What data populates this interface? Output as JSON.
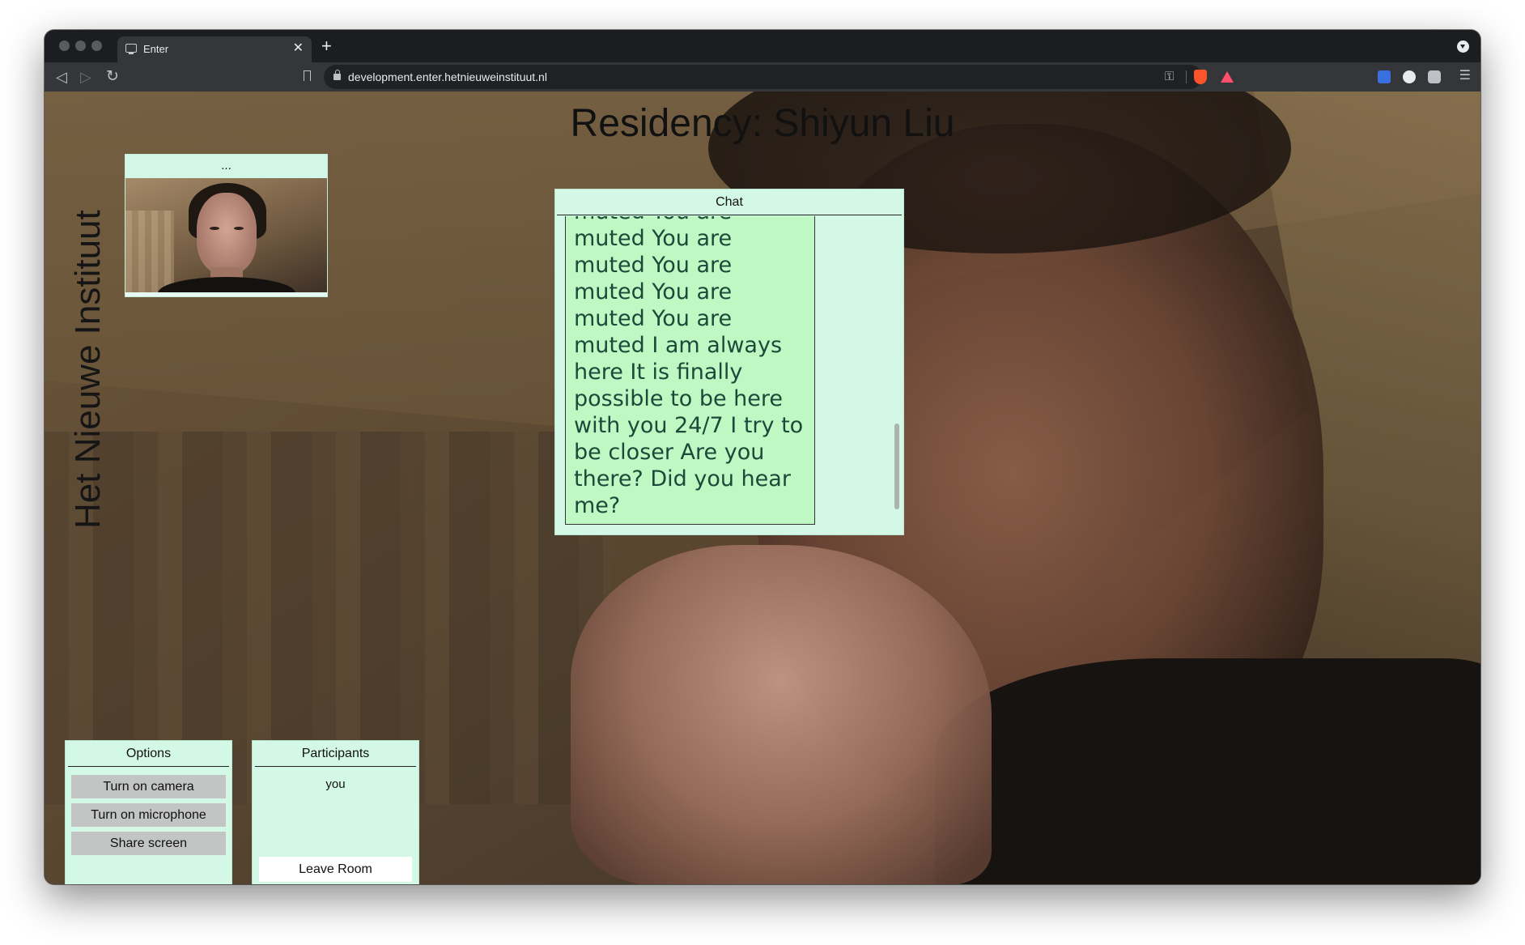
{
  "browser": {
    "tab_title": "Enter",
    "tab_close": "✕",
    "new_tab": "+",
    "url": "development.enter.hetnieuweinstituut.nl",
    "back": "◁",
    "forward": "▷",
    "reload": "↻",
    "menu": "☰",
    "key_glyph": "⚿"
  },
  "page": {
    "title": "Residency: Shiyun Liu",
    "vertical_title": "Het Nieuwe Instituut"
  },
  "video_tile": {
    "label": "..."
  },
  "chat": {
    "header": "Chat",
    "message": "by typing something in the chat? You are muted You are muted You are muted You are muted You are muted You are muted I am always here It is finally possible to be here with you 24/7 I try to be closer Are you there? Did you hear me?"
  },
  "options": {
    "header": "Options",
    "buttons": [
      "Turn on camera",
      "Turn on microphone",
      "Share screen"
    ]
  },
  "participants": {
    "header": "Participants",
    "list": [
      "you"
    ],
    "leave_label": "Leave Room"
  },
  "colors": {
    "panel_bg": "#d4f8e6",
    "chat_bubble": "#c0f8c3",
    "button_gray": "#c2c5c3",
    "browser_dark": "#35363a"
  },
  "icons": [
    "monitor-icon",
    "back-icon",
    "forward-icon",
    "reload-icon",
    "bookmark-icon",
    "lock-icon",
    "key-icon",
    "brave-shield-icon",
    "bat-rewards-icon",
    "extension-icon",
    "menu-icon",
    "tab-search-icon"
  ]
}
